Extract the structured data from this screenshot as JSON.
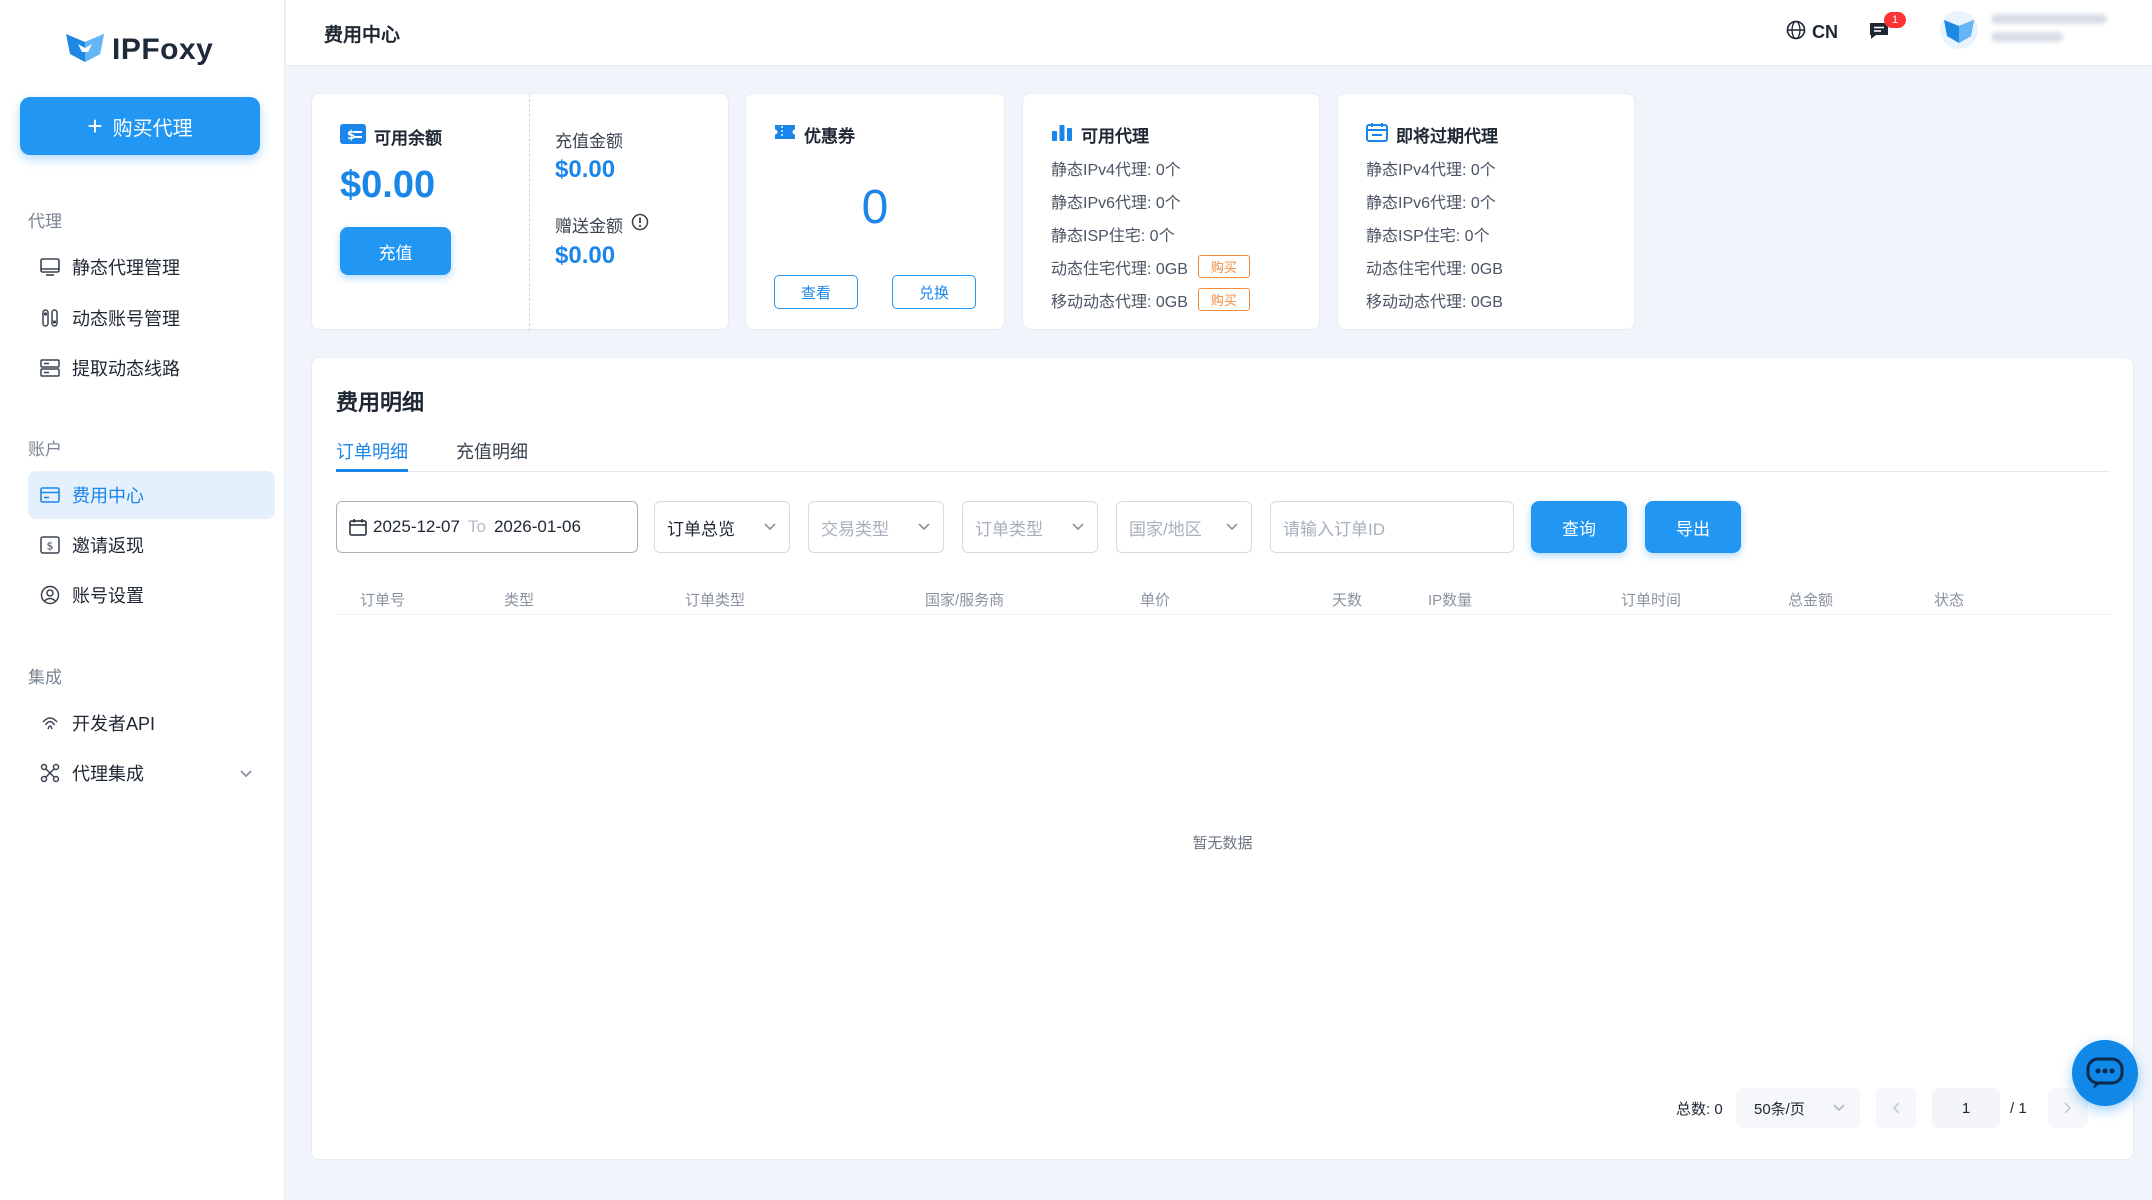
{
  "app": {
    "name": "IPFoxy"
  },
  "sidebar": {
    "buy_label": "购买代理",
    "sections": [
      {
        "label": "代理"
      },
      {
        "label": "账户"
      },
      {
        "label": "集成"
      }
    ],
    "items": [
      {
        "label": "静态代理管理",
        "icon": "monitor-icon"
      },
      {
        "label": "动态账号管理",
        "icon": "toggles-icon"
      },
      {
        "label": "提取动态线路",
        "icon": "server-icon"
      },
      {
        "label": "费用中心",
        "icon": "wallet-card-icon",
        "active": true
      },
      {
        "label": "邀请返现",
        "icon": "dollar-box-icon"
      },
      {
        "label": "账号设置",
        "icon": "user-circle-icon"
      },
      {
        "label": "开发者API",
        "icon": "fingerprint-icon"
      },
      {
        "label": "代理集成",
        "icon": "integration-icon"
      }
    ]
  },
  "header": {
    "title": "费用中心",
    "lang": "CN",
    "message_count": "1"
  },
  "balance_card": {
    "title": "可用余额",
    "amount": "$0.00",
    "recharge_label": "充值",
    "recharge_amount_label": "充值金额",
    "recharge_amount": "$0.00",
    "gift_amount_label": "赠送金额",
    "gift_amount": "$0.00"
  },
  "coupon_card": {
    "title": "优惠券",
    "count": "0",
    "view_label": "查看",
    "redeem_label": "兑换"
  },
  "available_card": {
    "title": "可用代理",
    "lines": [
      "静态IPv4代理: 0个",
      "静态IPv6代理: 0个",
      "静态ISP住宅: 0个",
      "动态住宅代理: 0GB",
      "移动动态代理: 0GB"
    ],
    "buy_label": "购买"
  },
  "expiring_card": {
    "title": "即将过期代理",
    "lines": [
      "静态IPv4代理: 0个",
      "静态IPv6代理: 0个",
      "静态ISP住宅: 0个",
      "动态住宅代理: 0GB",
      "移动动态代理: 0GB"
    ]
  },
  "detail": {
    "title": "费用明细",
    "tabs": [
      "订单明细",
      "充值明细"
    ],
    "filters": {
      "date_start": "2025-12-07",
      "date_to": "To",
      "date_end": "2026-01-06",
      "order_scope": "订单总览",
      "trade_type_placeholder": "交易类型",
      "order_type_placeholder": "订单类型",
      "country_placeholder": "国家/地区",
      "order_id_placeholder": "请输入订单ID",
      "query_label": "查询",
      "export_label": "导出"
    },
    "columns": [
      "订单号",
      "类型",
      "订单类型",
      "国家/服务商",
      "单价",
      "天数",
      "IP数量",
      "订单时间",
      "总金额",
      "状态"
    ],
    "empty_text": "暂无数据",
    "pagination": {
      "total_label": "总数: 0",
      "page_size": "50条/页",
      "current_page": "1",
      "total_pages": "/ 1"
    }
  }
}
